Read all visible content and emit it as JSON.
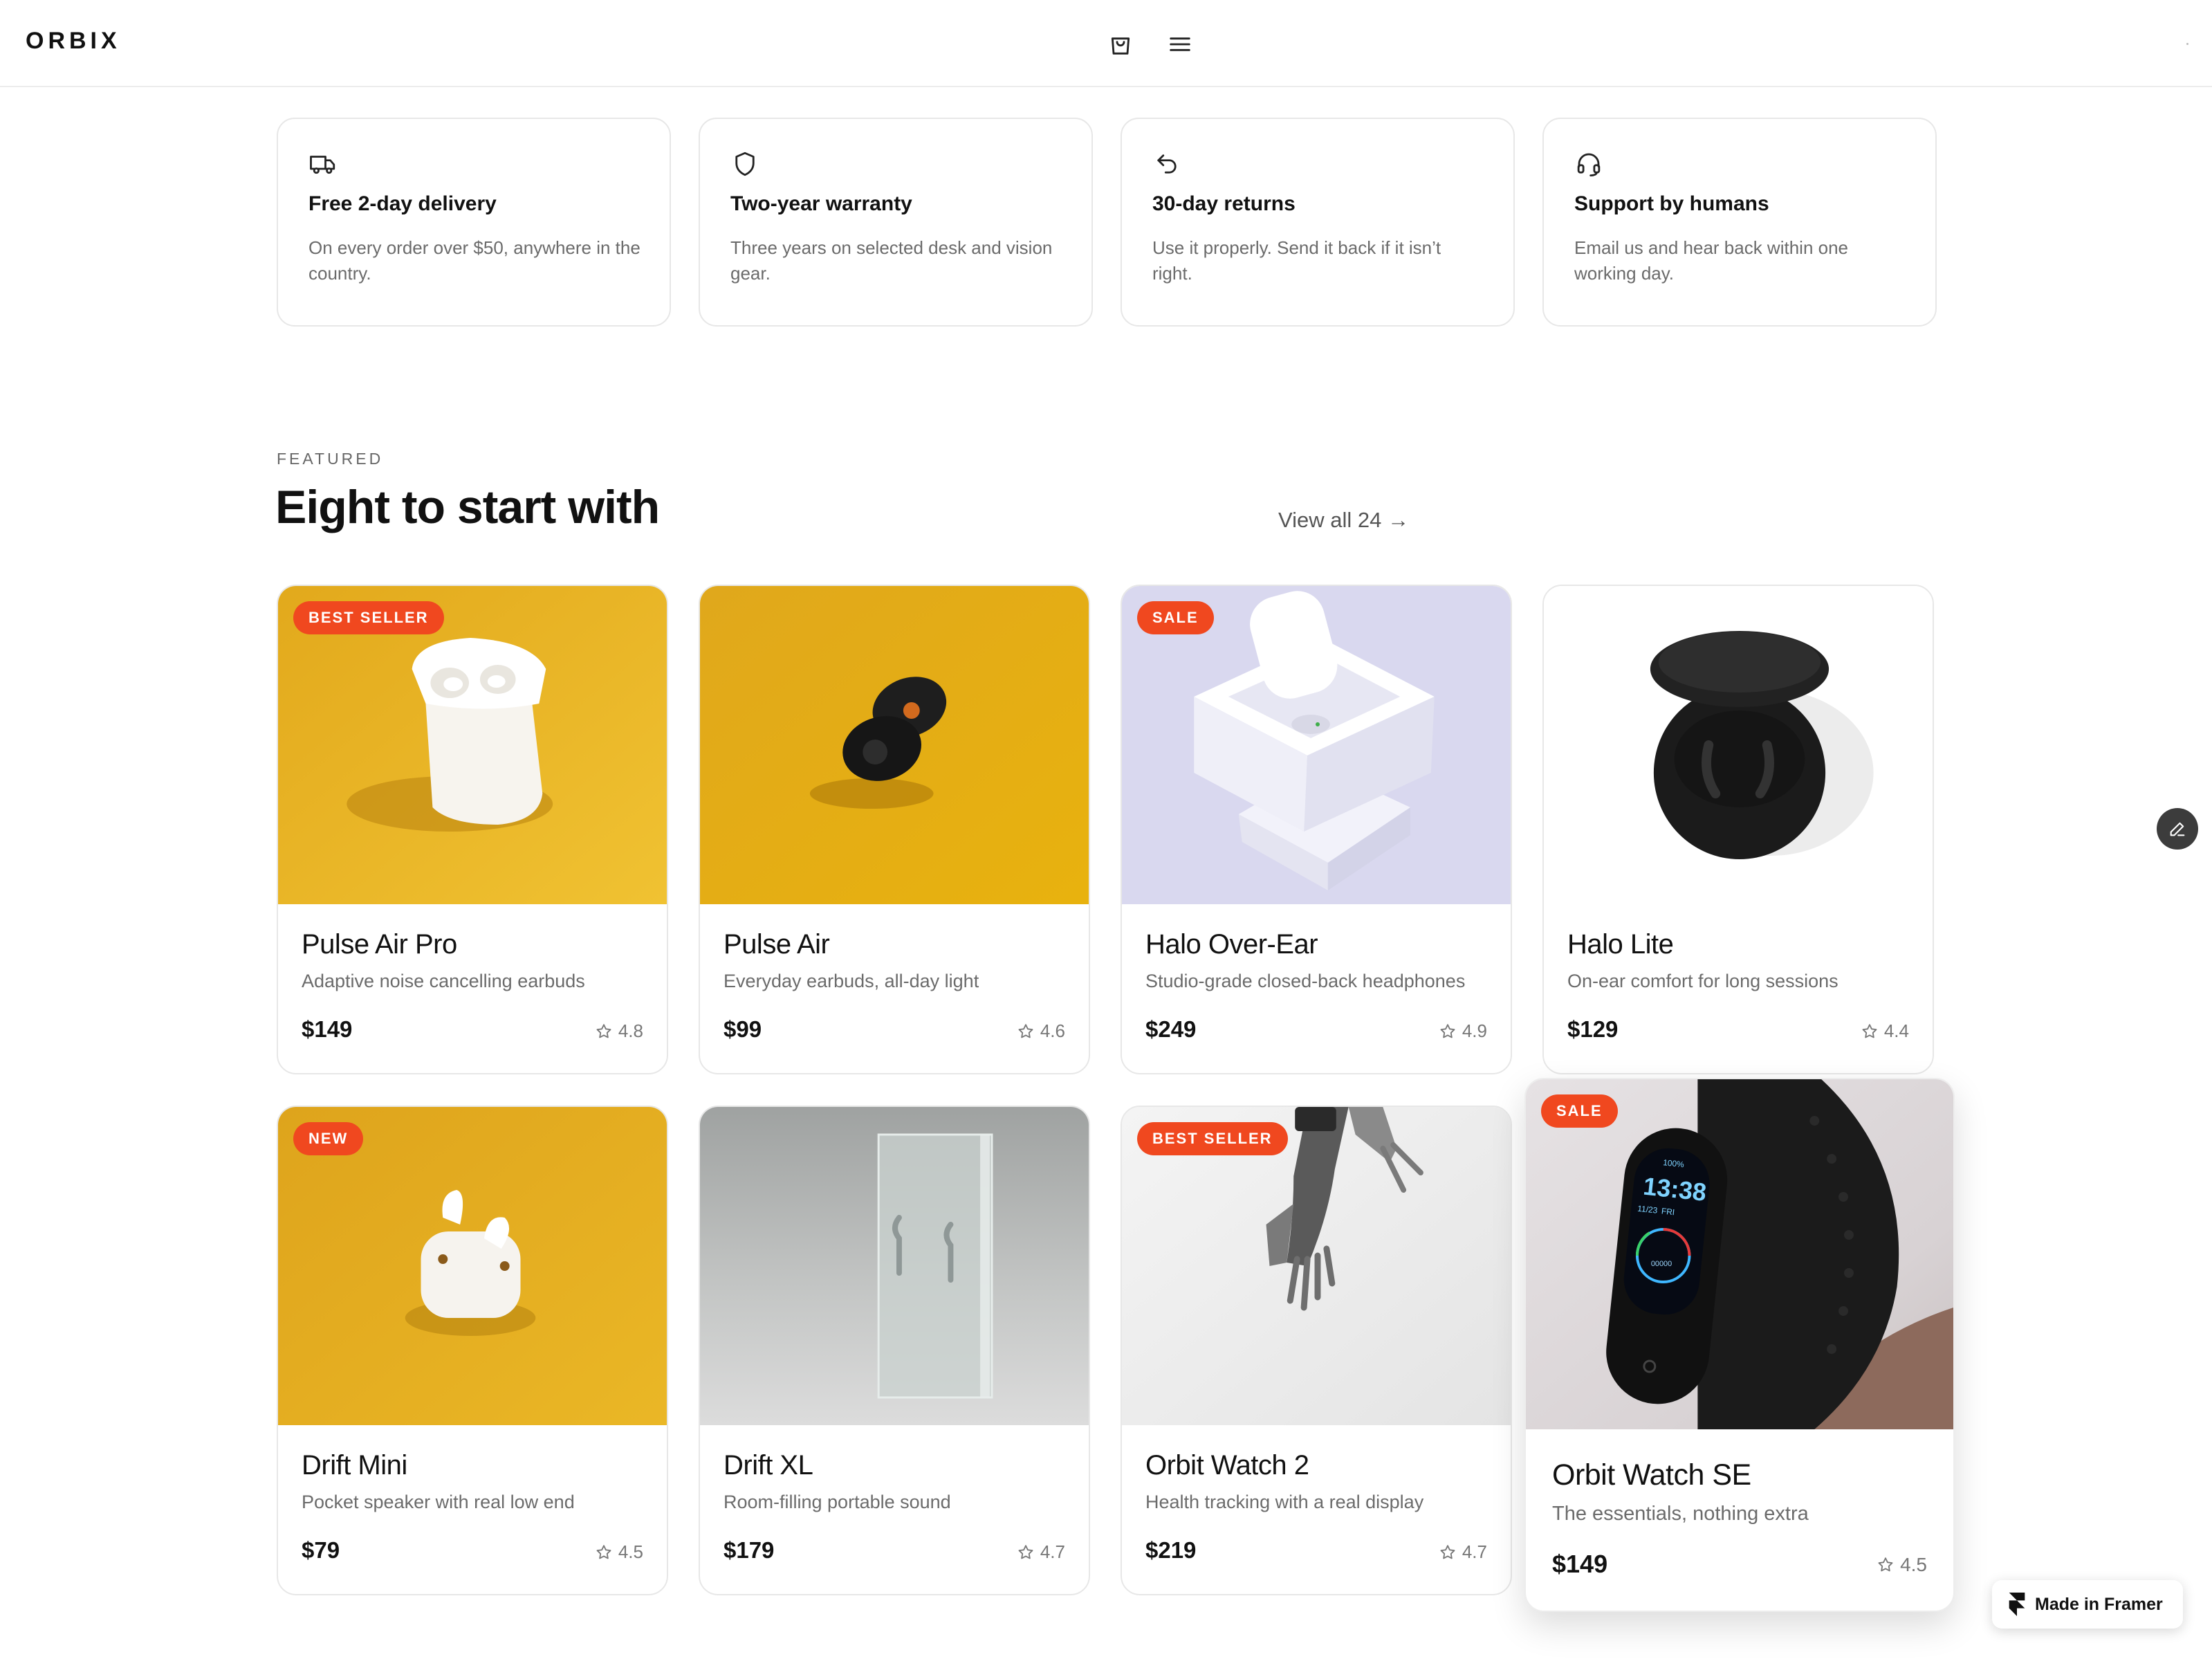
{
  "header": {
    "logo": "ORBIX",
    "icons": [
      "shopping-bag-icon",
      "menu-icon"
    ]
  },
  "features": [
    {
      "icon": "truck-icon",
      "title": "Free 2-day delivery",
      "desc": "On every order over $50, anywhere in the country."
    },
    {
      "icon": "shield-icon",
      "title": "Two-year warranty",
      "desc": "Three years on selected desk and vision gear."
    },
    {
      "icon": "return-arrow-icon",
      "title": "30-day returns",
      "desc": "Use it properly. Send it back if it isn’t right."
    },
    {
      "icon": "headset-icon",
      "title": "Support by humans",
      "desc": "Email us and hear back within one working day."
    }
  ],
  "section": {
    "eyebrow": "FEATURED",
    "title": "Eight to start with",
    "view_all": "View all 24 →"
  },
  "products": [
    {
      "name": "Pulse Air Pro",
      "desc": "Adaptive noise cancelling earbuds",
      "price": "$149",
      "rating": "4.8",
      "badge": "BEST SELLER"
    },
    {
      "name": "Pulse Air",
      "desc": "Everyday earbuds, all-day light",
      "price": "$99",
      "rating": "4.6",
      "badge": ""
    },
    {
      "name": "Halo Over-Ear",
      "desc": "Studio-grade closed-back headphones",
      "price": "$249",
      "rating": "4.9",
      "badge": "SALE"
    },
    {
      "name": "Halo Lite",
      "desc": "On-ear comfort for long sessions",
      "price": "$129",
      "rating": "4.4",
      "badge": ""
    },
    {
      "name": "Drift Mini",
      "desc": "Pocket speaker with real low end",
      "price": "$79",
      "rating": "4.5",
      "badge": "NEW"
    },
    {
      "name": "Drift XL",
      "desc": "Room-filling portable sound",
      "price": "$179",
      "rating": "4.7",
      "badge": ""
    },
    {
      "name": "Orbit Watch 2",
      "desc": "Health tracking with a real display",
      "price": "$219",
      "rating": "4.7",
      "badge": "BEST SELLER"
    },
    {
      "name": "Orbit Watch SE",
      "desc": "The essentials, nothing extra",
      "price": "$149",
      "rating": "4.5",
      "badge": "SALE",
      "watch_time": "13:38",
      "watch_battery": "100%",
      "watch_date": "11/23",
      "watch_day": "FRI",
      "watch_steps": "00000"
    }
  ],
  "colors": {
    "badge": "#f0481f",
    "accent_yellow": "#e8b21f",
    "text": "#111111",
    "muted": "#6b6b6b"
  },
  "framer_badge": "Made in Framer",
  "edit_button_icon": "pencil-icon"
}
